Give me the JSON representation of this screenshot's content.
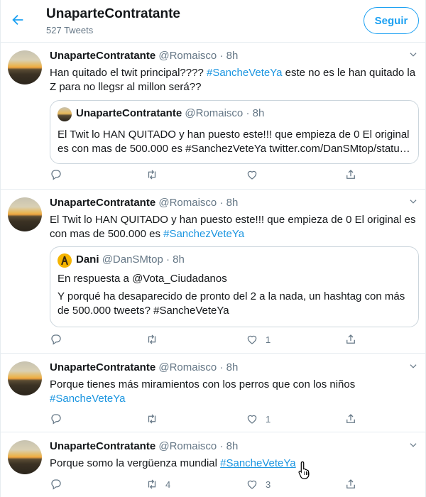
{
  "header": {
    "title": "UnaparteContratante",
    "tweet_count": "527 Tweets",
    "follow_label": "Seguir"
  },
  "tweets": [
    {
      "name": "UnaparteContratante",
      "handle": "@Romaisco",
      "time": "· 8h",
      "text_plain": "Han quitado el twit principal???? ",
      "text_tag": "#SancheVeteYa",
      "text_rest": " este no es le han quitado la Z para no llegsr al millon será??",
      "quote": {
        "name": "UnaparteContratante",
        "handle": "@Romaisco",
        "time": "· 8h",
        "text": "El Twit lo HAN QUITADO y han puesto este!!! que empieza de 0 El original es con mas de 500.000 es #SanchezVeteYa twitter.com/DanSMtop/statu…"
      },
      "replies": "",
      "retweets": "",
      "likes": ""
    },
    {
      "name": "UnaparteContratante",
      "handle": "@Romaisco",
      "time": "· 8h",
      "text_plain": "El Twit lo HAN QUITADO y han puesto este!!! que empieza de 0 El original es con mas de 500.000 es ",
      "text_tag": "#SanchezVeteYa",
      "quote": {
        "name": "Dani",
        "handle": "@DanSMtop",
        "time": "· 8h",
        "reply_to": "En respuesta a @Vota_Ciudadanos",
        "text": "Y porqué ha desaparecido de pronto del 2 a la nada, un hashtag con más de 500.000 tweets?  #SancheVeteYa"
      },
      "replies": "",
      "retweets": "",
      "likes": "1"
    },
    {
      "name": "UnaparteContratante",
      "handle": "@Romaisco",
      "time": "· 8h",
      "text_plain": "Porque tienes más miramientos con los perros que con los niños",
      "text_tag": "#SancheVeteYa",
      "replies": "",
      "retweets": "",
      "likes": "1"
    },
    {
      "name": "UnaparteContratante",
      "handle": "@Romaisco",
      "time": "· 8h",
      "text_plain": "Porque somo la vergüenza mundial ",
      "text_tag": "#SancheVeteYa",
      "replies": "",
      "retweets": "4",
      "likes": "3"
    }
  ],
  "icons": {
    "back": "arrow-left-icon",
    "caret": "chevron-down-icon",
    "reply": "reply-icon",
    "retweet": "retweet-icon",
    "like": "heart-icon",
    "share": "share-icon",
    "cursor": "hand-pointer-icon"
  },
  "colors": {
    "accent": "#1da1f2",
    "hashtag": "#1b95e0",
    "muted": "#657786",
    "border": "#e6ecf0"
  }
}
